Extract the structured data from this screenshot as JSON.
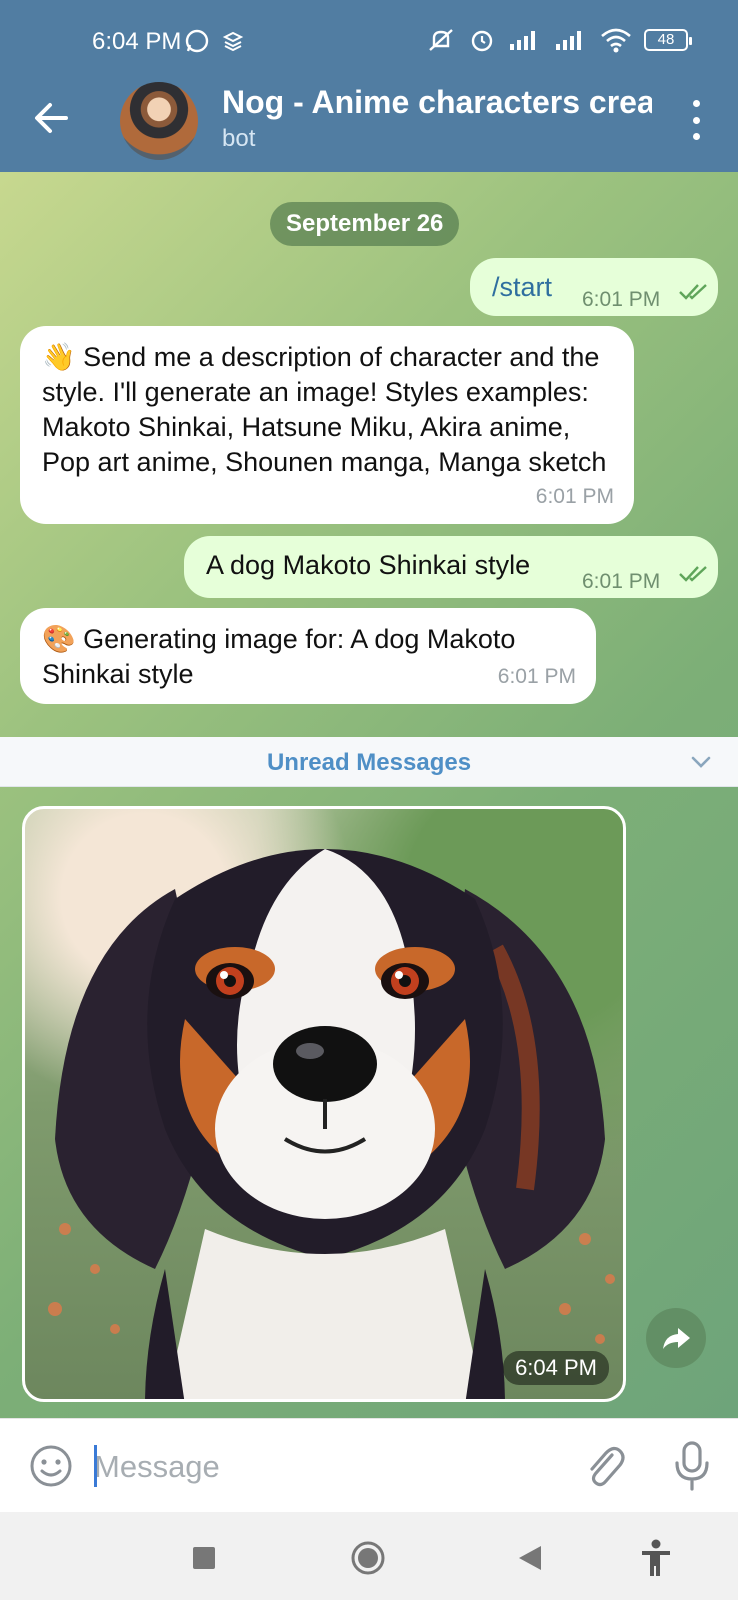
{
  "status_bar": {
    "time": "6:04 PM",
    "battery": "48",
    "icons": [
      "whatsapp-icon",
      "app-icon",
      "mute-icon",
      "alarm-icon",
      "signal-icon",
      "signal-icon",
      "wifi-icon",
      "battery-icon"
    ]
  },
  "header": {
    "title": "Nog - Anime characters crea",
    "subtitle": "bot"
  },
  "chat": {
    "date_chip": "September 26",
    "messages": [
      {
        "direction": "out",
        "text": "/start",
        "time": "6:01 PM"
      },
      {
        "direction": "in",
        "emoji": "👋",
        "text": "Send me a description of character and the style. I'll generate an image! Styles examples: Makoto Shinkai, Hatsune Miku, Akira anime, Pop art anime, Shounen manga, Manga sketch",
        "time": "6:01 PM"
      },
      {
        "direction": "out",
        "text": "A dog Makoto Shinkai style",
        "time": "6:01 PM"
      },
      {
        "direction": "in",
        "emoji": "🎨",
        "text": "Generating image for: A dog Makoto Shinkai style",
        "time": "6:01 PM"
      }
    ],
    "unread_label": "Unread Messages",
    "photo": {
      "time": "6:04 PM"
    }
  },
  "input": {
    "placeholder": "Message",
    "value": ""
  },
  "colors": {
    "header": "#517da2",
    "outgoing_bubble": "#e6ffd9",
    "incoming_bubble": "#ffffff",
    "unread_text": "#4f8fc6"
  }
}
